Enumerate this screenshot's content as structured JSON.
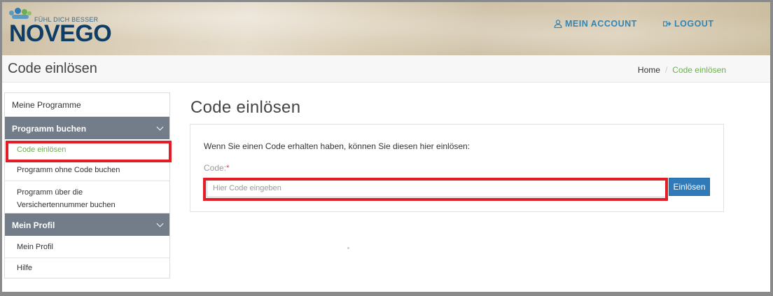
{
  "header": {
    "brand": "NOVEGO",
    "tagline": "FÜHL DICH BESSER",
    "nav": [
      {
        "label": "MEIN ACCOUNT",
        "icon": "user-icon"
      },
      {
        "label": "LOGOUT",
        "icon": "logout-icon"
      }
    ]
  },
  "titlebar": {
    "title": "Code einlösen",
    "breadcrumb": {
      "home": "Home",
      "separator": "/",
      "current": "Code einlösen"
    }
  },
  "sidebar": {
    "top_item": "Meine Programme",
    "group1": {
      "title": "Programm buchen",
      "items": [
        {
          "label": "Code einlösen",
          "active": true
        },
        {
          "label": "Programm ohne Code buchen"
        },
        {
          "label": "Programm über die Versichertennummer buchen"
        }
      ]
    },
    "group2": {
      "title": "Mein Profil",
      "items": [
        {
          "label": "Mein Profil"
        },
        {
          "label": "Hilfe"
        }
      ]
    }
  },
  "main": {
    "title": "Code einlösen",
    "intro": "Wenn Sie einen Code erhalten haben, können Sie diesen hier einlösen:",
    "code_label": "Code:",
    "required_mark": "*",
    "code_value": "",
    "code_placeholder": "Hier Code eingeben",
    "submit_label": "Einlösen"
  },
  "colors": {
    "brand_dark": "#0e3d66",
    "nav_link": "#2f86b7",
    "active_green": "#6ab04c",
    "sidebar_header": "#737c89",
    "button_blue": "#2f7ab8",
    "highlight_red": "#e21d25"
  }
}
